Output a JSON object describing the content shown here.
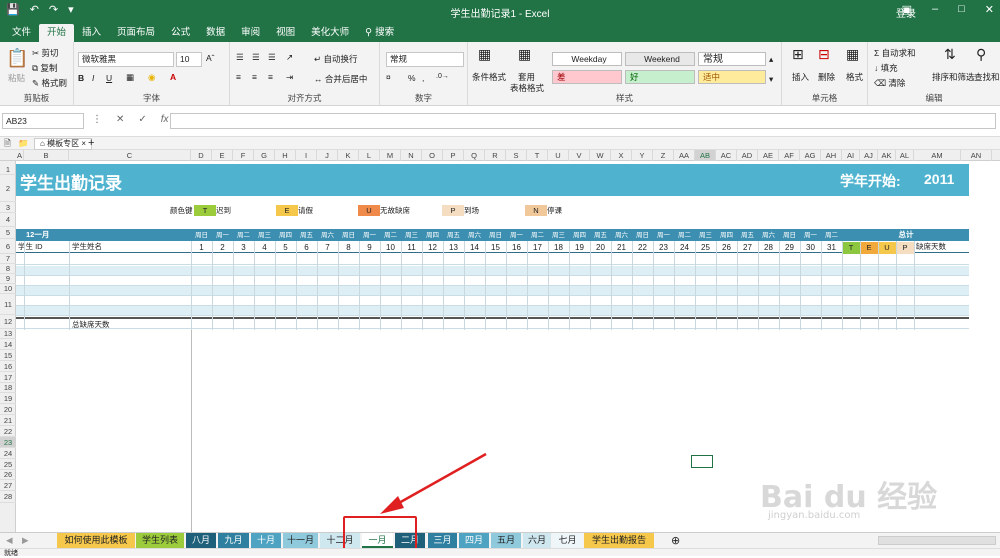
{
  "window": {
    "title": "学生出勤记录1  -  Excel",
    "login": "登录"
  },
  "tabs": [
    "文件",
    "开始",
    "插入",
    "页面布局",
    "公式",
    "数据",
    "审阅",
    "视图",
    "美化大师"
  ],
  "search_label": "搜索",
  "clipboard": {
    "paste": "粘贴",
    "cut": "剪切",
    "copy": "复制",
    "format_painter": "格式刷",
    "label": "剪贴板"
  },
  "font": {
    "name": "微软雅黑",
    "size": "10",
    "bold": "B",
    "italic": "I",
    "underline": "U",
    "label": "字体"
  },
  "alignment": {
    "wrap": "自动换行",
    "merge": "合并后居中",
    "label": "对齐方式"
  },
  "number": {
    "format": "常规",
    "percent": "%",
    "comma": ",",
    "label": "数字"
  },
  "styles": {
    "cond": "条件格式",
    "table": "套用",
    "table2": "表格格式",
    "label": "样式",
    "cells": [
      {
        "text": "Weekday",
        "bg": "#ffffff"
      },
      {
        "text": "Weekend",
        "bg": "#e8e8e8"
      },
      {
        "text": "常规",
        "bg": "#ffffff"
      },
      {
        "text": "差",
        "bg": "#ffc7ce"
      },
      {
        "text": "好",
        "bg": "#c6efce"
      },
      {
        "text": "适中",
        "bg": "#ffeb9c"
      }
    ]
  },
  "cells_group": {
    "insert": "插入",
    "delete": "删除",
    "format": "格式",
    "label": "单元格"
  },
  "editing": {
    "autosum": "自动求和",
    "fill": "填充",
    "clear": "清除",
    "sort": "排序和筛选",
    "find": "查找和",
    "label": "编辑"
  },
  "formula_bar": {
    "name_box": "AB23",
    "fx": "fx"
  },
  "doc_tab": "模板专区",
  "columns": [
    "A",
    "B",
    "C",
    "D",
    "E",
    "F",
    "G",
    "H",
    "I",
    "J",
    "K",
    "L",
    "M",
    "N",
    "O",
    "P",
    "Q",
    "R",
    "S",
    "T",
    "U",
    "V",
    "W",
    "X",
    "Y",
    "Z",
    "AA",
    "AB",
    "AC",
    "AD",
    "AE",
    "AF",
    "AG",
    "AH",
    "AI",
    "AJ",
    "AK",
    "AL",
    "AM",
    "AN"
  ],
  "rows": [
    "1",
    "2",
    "3",
    "4",
    "5",
    "6",
    "7",
    "8",
    "9",
    "10",
    "11",
    "12",
    "13",
    "14",
    "15",
    "16",
    "17",
    "18",
    "19",
    "20",
    "21",
    "22",
    "23",
    "24",
    "25",
    "26",
    "27",
    "28"
  ],
  "sheet": {
    "title": "学生出勤记录",
    "year_label": "学年开始:",
    "year": "2011",
    "legend_label": "颜色键",
    "legend": [
      {
        "key": "T",
        "text": "迟到",
        "color": "#9ccc3c"
      },
      {
        "key": "E",
        "text": "请假",
        "color": "#f5c84c"
      },
      {
        "key": "U",
        "text": "无故缺席",
        "color": "#f08a4b"
      },
      {
        "key": "P",
        "text": "到场",
        "color": "#f4ddc0"
      },
      {
        "key": "N",
        "text": "停课",
        "color": "#f0c89a"
      }
    ],
    "month": "12一月",
    "student_id": "学生 ID",
    "student_name": "学生姓名",
    "total_label": "总计",
    "absent_days": "缺席天数",
    "summary": "总缺席天数",
    "weekdays": [
      "周日",
      "周一",
      "周二",
      "周三",
      "周四",
      "周五",
      "周六",
      "周日",
      "周一",
      "周二",
      "周三",
      "周四",
      "周五",
      "周六",
      "周日",
      "周一",
      "周二",
      "周三",
      "周四",
      "周五",
      "周六",
      "周日",
      "周一",
      "周二",
      "周三",
      "周四",
      "周五",
      "周六",
      "周日",
      "周一",
      "周二"
    ],
    "days": [
      "1",
      "2",
      "3",
      "4",
      "5",
      "6",
      "7",
      "8",
      "9",
      "10",
      "11",
      "12",
      "13",
      "14",
      "15",
      "16",
      "17",
      "18",
      "19",
      "20",
      "21",
      "22",
      "23",
      "24",
      "25",
      "26",
      "27",
      "28",
      "29",
      "30",
      "31"
    ],
    "totals": [
      {
        "k": "T",
        "c": "#8dc63f"
      },
      {
        "k": "E",
        "c": "#f2a93b"
      },
      {
        "k": "U",
        "c": "#f5c84c"
      },
      {
        "k": "P",
        "c": "#f4ddc0"
      }
    ]
  },
  "sheet_tabs": [
    {
      "t": "如何使用此模板",
      "bg": "#f5c84c"
    },
    {
      "t": "学生列表",
      "bg": "#9ccc3c"
    },
    {
      "t": "八月",
      "bg": "#1e5f7a"
    },
    {
      "t": "九月",
      "bg": "#2f80a0"
    },
    {
      "t": "十月",
      "bg": "#4fa3c2"
    },
    {
      "t": "十一月",
      "bg": "#8fc9dc"
    },
    {
      "t": "十二月",
      "bg": "#cfe7ef"
    },
    {
      "t": "一月",
      "bg": "#ffffff"
    },
    {
      "t": "二月",
      "bg": "#1e5f7a"
    },
    {
      "t": "三月",
      "bg": "#2f80a0"
    },
    {
      "t": "四月",
      "bg": "#4fa3c2"
    },
    {
      "t": "五月",
      "bg": "#8fc9dc"
    },
    {
      "t": "六月",
      "bg": "#cfe7ef"
    },
    {
      "t": "七月",
      "bg": "#eef6f9"
    },
    {
      "t": "学生出勤报告",
      "bg": "#f5c84c"
    }
  ],
  "status": "就绪",
  "watermark": {
    "main": "Bai du 经验",
    "sub": "jingyan.baidu.com"
  }
}
